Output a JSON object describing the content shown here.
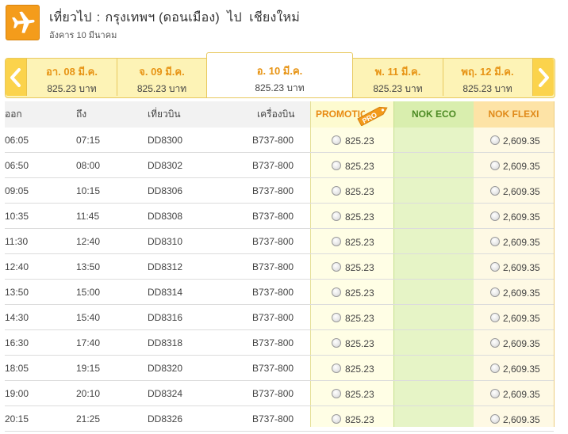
{
  "header": {
    "direction": "เที่ยวไป",
    "separator": ":",
    "origin": "กรุงเทพฯ (ดอนเมือง)",
    "to": "ไป",
    "destination": "เชียงใหม่",
    "date": "อังคาร 10 มีนาคม",
    "icon": "airplane-icon",
    "accent": "#f49c1b"
  },
  "date_strip": [
    {
      "date": "อา. 08 มี.ค.",
      "price": "825.23 บาท",
      "selected": false
    },
    {
      "date": "จ. 09 มี.ค.",
      "price": "825.23 บาท",
      "selected": false
    },
    {
      "date": "อ. 10 มี.ค.",
      "price": "825.23 บาท",
      "selected": true
    },
    {
      "date": "พ. 11 มี.ค.",
      "price": "825.23 บาท",
      "selected": false
    },
    {
      "date": "พฤ. 12 มี.ค.",
      "price": "825.23 บาท",
      "selected": false
    }
  ],
  "columns": {
    "depart": "ออก",
    "arrive": "ถึง",
    "flight": "เที่ยวบิน",
    "aircraft": "เครื่องบิน",
    "promo": "PROMOTION",
    "promo_badge": "PRO",
    "eco": "NOK ECO",
    "flexi": "NOK FLEXI"
  },
  "flights": [
    {
      "dep": "06:05",
      "arr": "07:15",
      "flight": "DD8300",
      "aircraft": "B737-800",
      "promo": "825.23",
      "flexi": "2,609.35"
    },
    {
      "dep": "06:50",
      "arr": "08:00",
      "flight": "DD8302",
      "aircraft": "B737-800",
      "promo": "825.23",
      "flexi": "2,609.35"
    },
    {
      "dep": "09:05",
      "arr": "10:15",
      "flight": "DD8306",
      "aircraft": "B737-800",
      "promo": "825.23",
      "flexi": "2,609.35"
    },
    {
      "dep": "10:35",
      "arr": "11:45",
      "flight": "DD8308",
      "aircraft": "B737-800",
      "promo": "825.23",
      "flexi": "2,609.35"
    },
    {
      "dep": "11:30",
      "arr": "12:40",
      "flight": "DD8310",
      "aircraft": "B737-800",
      "promo": "825.23",
      "flexi": "2,609.35"
    },
    {
      "dep": "12:40",
      "arr": "13:50",
      "flight": "DD8312",
      "aircraft": "B737-800",
      "promo": "825.23",
      "flexi": "2,609.35"
    },
    {
      "dep": "13:50",
      "arr": "15:00",
      "flight": "DD8314",
      "aircraft": "B737-800",
      "promo": "825.23",
      "flexi": "2,609.35"
    },
    {
      "dep": "14:30",
      "arr": "15:40",
      "flight": "DD8316",
      "aircraft": "B737-800",
      "promo": "825.23",
      "flexi": "2,609.35"
    },
    {
      "dep": "16:30",
      "arr": "17:40",
      "flight": "DD8318",
      "aircraft": "B737-800",
      "promo": "825.23",
      "flexi": "2,609.35"
    },
    {
      "dep": "18:05",
      "arr": "19:15",
      "flight": "DD8320",
      "aircraft": "B737-800",
      "promo": "825.23",
      "flexi": "2,609.35"
    },
    {
      "dep": "19:00",
      "arr": "20:10",
      "flight": "DD8324",
      "aircraft": "B737-800",
      "promo": "825.23",
      "flexi": "2,609.35"
    },
    {
      "dep": "20:15",
      "arr": "21:25",
      "flight": "DD8326",
      "aircraft": "B737-800",
      "promo": "825.23",
      "flexi": "2,609.35"
    }
  ]
}
